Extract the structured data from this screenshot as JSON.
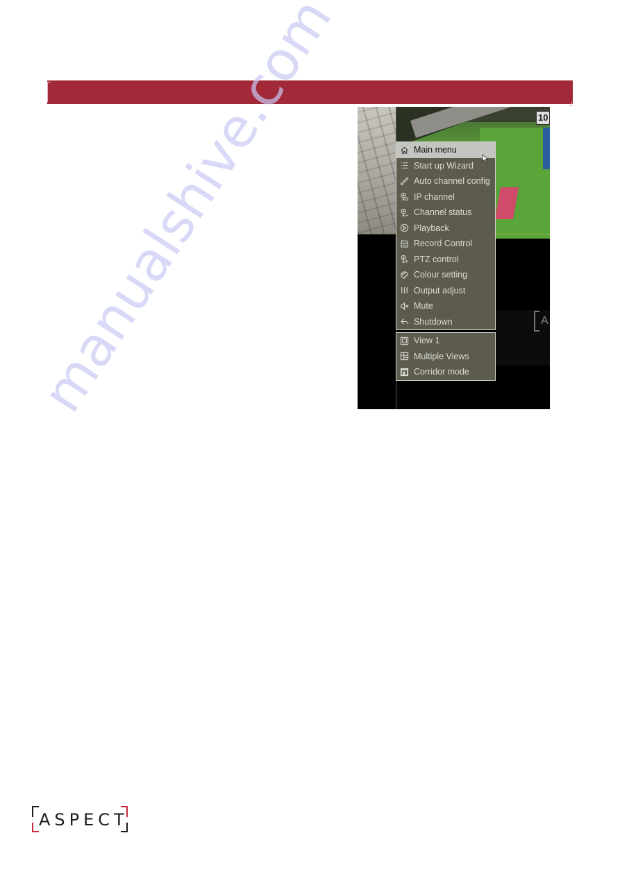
{
  "header": {
    "color": "#a22a38"
  },
  "screenshot": {
    "camera_sign_text": "10",
    "mini_logo_text": "A"
  },
  "context_menu": {
    "primary_items": [
      {
        "label": "Main menu",
        "icon": "home-icon",
        "active": true
      },
      {
        "label": "Start up Wizard",
        "icon": "list-icon"
      },
      {
        "label": "Auto channel config",
        "icon": "link-nodes-icon"
      },
      {
        "label": "IP channel",
        "icon": "ip-camera-icon"
      },
      {
        "label": "Channel status",
        "icon": "camera-check-icon"
      },
      {
        "label": "Playback",
        "icon": "play-circle-icon"
      },
      {
        "label": "Record Control",
        "icon": "record-icon"
      },
      {
        "label": "PTZ control",
        "icon": "ptz-camera-icon"
      },
      {
        "label": "Colour setting",
        "icon": "palette-icon"
      },
      {
        "label": "Output adjust",
        "icon": "sliders-icon"
      },
      {
        "label": "Mute",
        "icon": "speaker-mute-icon"
      },
      {
        "label": "Shutdown",
        "icon": "shutdown-icon"
      }
    ],
    "view_items": [
      {
        "label": "View 1",
        "icon": "single-view-icon"
      },
      {
        "label": "Multiple Views",
        "icon": "grid-view-icon"
      },
      {
        "label": "Corridor mode",
        "icon": "corridor-icon"
      }
    ]
  },
  "watermark": {
    "text": "manualshive.com"
  },
  "footer": {
    "logo_text": "ASPECT",
    "accent_color": "#c8283a"
  }
}
